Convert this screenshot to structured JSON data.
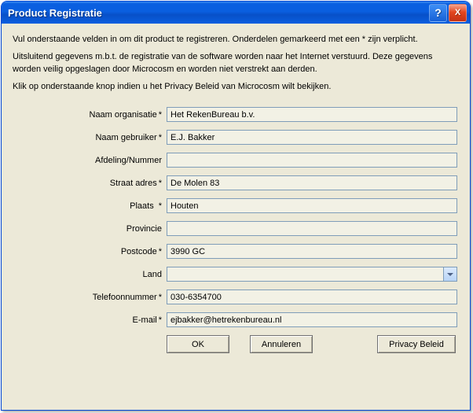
{
  "window": {
    "title": "Product Registratie"
  },
  "instructions": {
    "line1": "Vul onderstaande velden in om dit product te registreren. Onderdelen gemarkeerd met een * zijn verplicht.",
    "line2": "Uitsluitend gegevens m.b.t. de registratie van de software worden naar het Internet verstuurd. Deze gegevens worden veilig opgeslagen door Microcosm en worden niet verstrekt aan derden.",
    "line3": "Klik op onderstaande knop indien u het Privacy Beleid van Microcosm wilt bekijken."
  },
  "labels": {
    "org": "Naam organisatie",
    "user": "Naam gebruiker",
    "dept": "Afdeling/Nummer",
    "street": "Straat adres",
    "city": "Plaats",
    "province": "Provincie",
    "postcode": "Postcode",
    "country": "Land",
    "phone": "Telefoonnummer",
    "email": "E-mail",
    "star": "*"
  },
  "values": {
    "org": "Het RekenBureau b.v.",
    "user": "E.J. Bakker",
    "dept": "",
    "street": "De Molen 83",
    "city": "Houten",
    "province": "",
    "postcode": "3990 GC",
    "country": "",
    "phone": "030-6354700",
    "email": "ejbakker@hetrekenbureau.nl"
  },
  "buttons": {
    "ok": "OK",
    "cancel": "Annuleren",
    "privacy": "Privacy Beleid"
  },
  "titlebar": {
    "help": "?",
    "close": "X"
  }
}
